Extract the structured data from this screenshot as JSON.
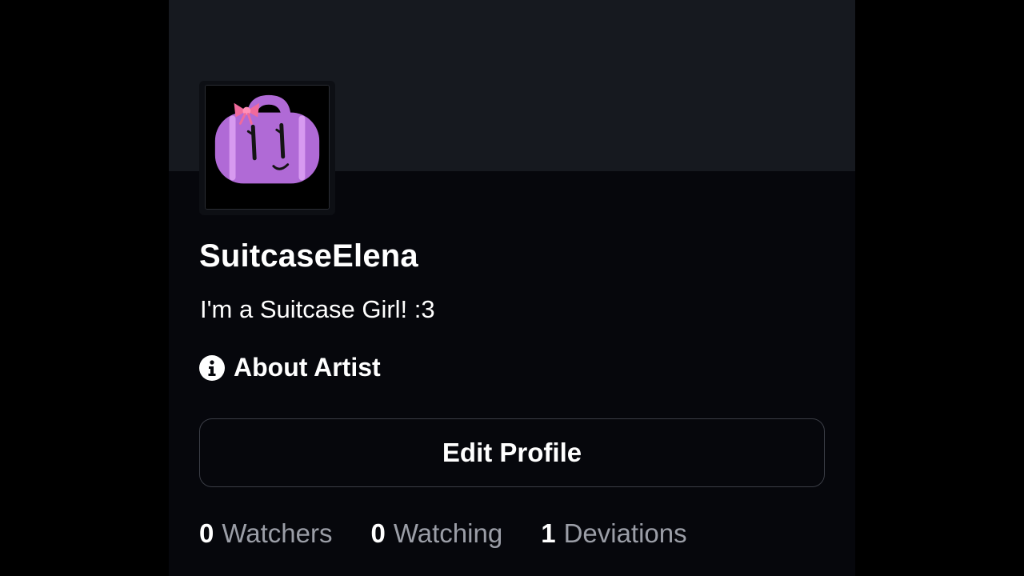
{
  "profile": {
    "username": "SuitcaseElena",
    "tagline": "I'm a Suitcase Girl! :3",
    "about_label": "About Artist",
    "edit_label": "Edit Profile",
    "avatar_icon": "purple-suitcase-avatar",
    "info_icon": "info-icon"
  },
  "stats": [
    {
      "count": "0",
      "label": "Watchers"
    },
    {
      "count": "0",
      "label": "Watching"
    },
    {
      "count": "1",
      "label": "Deviations"
    }
  ],
  "colors": {
    "page_background": "#000000",
    "panel_background": "#06070c",
    "banner_background": "#16191f",
    "button_border": "#3b3e46",
    "muted_text": "#9b9ea7",
    "avatar_purple": "#b06ad6",
    "bow_pink": "#f06a9c"
  }
}
